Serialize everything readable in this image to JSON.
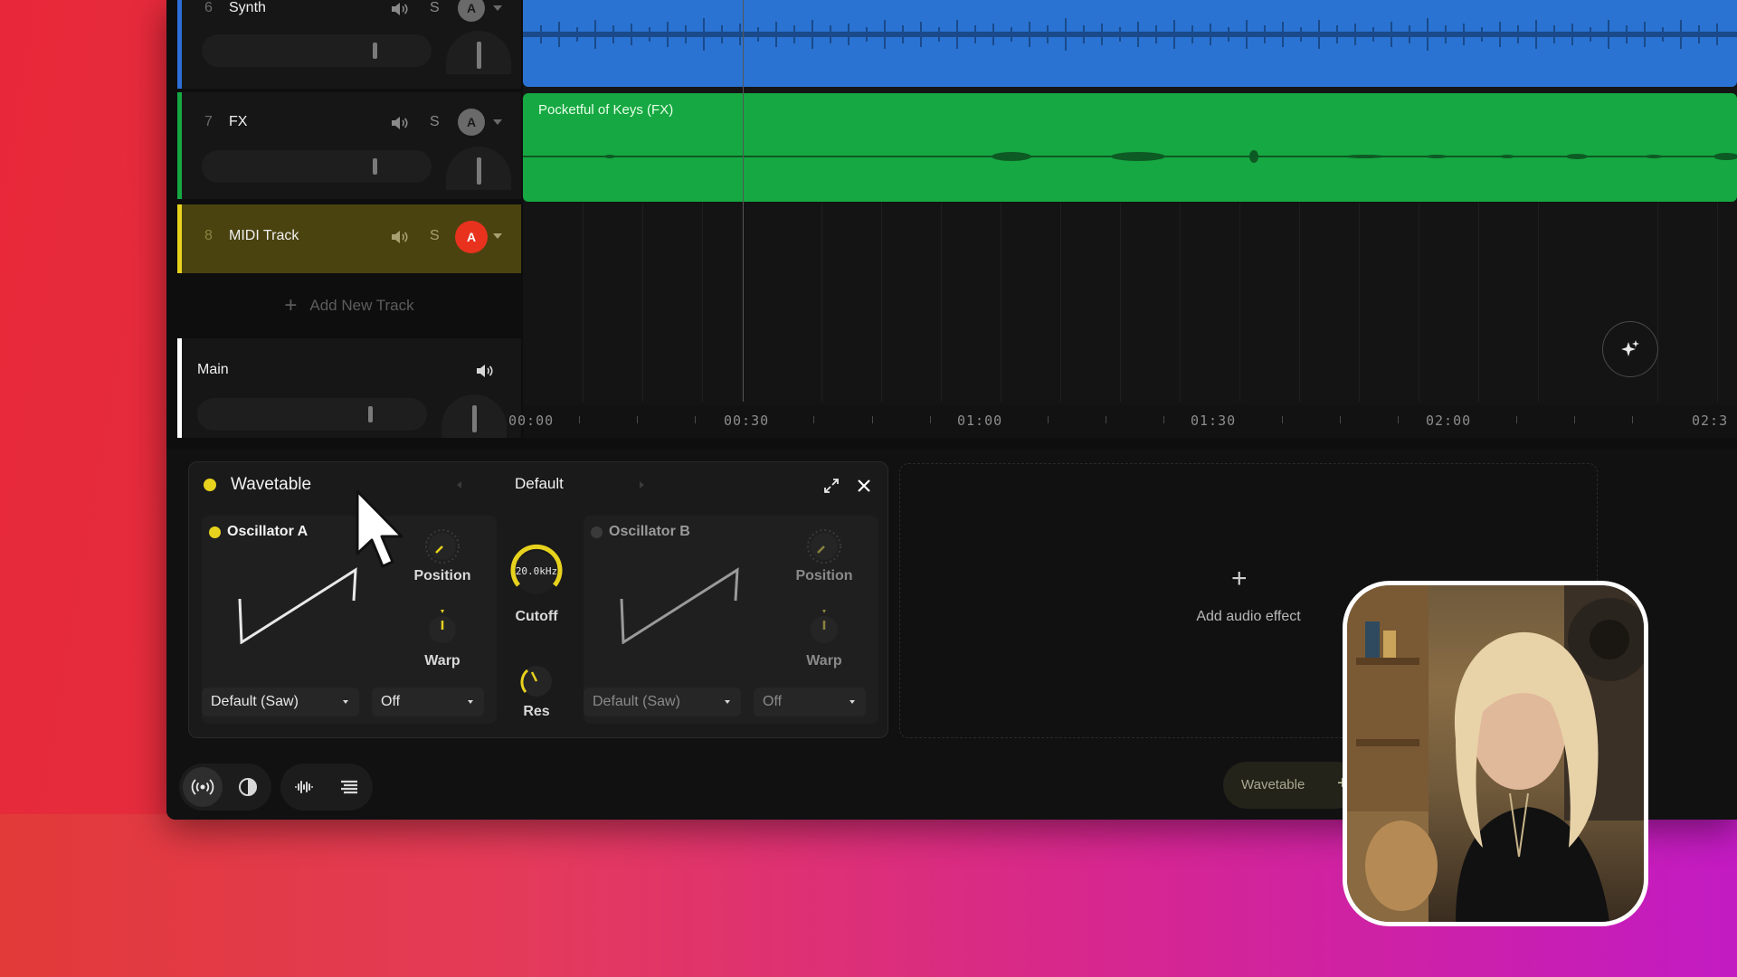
{
  "tracks": [
    {
      "num": "6",
      "name": "Synth",
      "solo": "S",
      "arm": "A"
    },
    {
      "num": "7",
      "name": "FX",
      "solo": "S",
      "arm": "A"
    },
    {
      "num": "8",
      "name": "MIDI Track",
      "solo": "S",
      "arm": "A"
    }
  ],
  "add_track_label": "Add New Track",
  "main_track": {
    "name": "Main"
  },
  "clips": {
    "fx_name": "Pocketful of Keys (FX)"
  },
  "ruler": [
    "00:00",
    "00:30",
    "01:00",
    "01:30",
    "02:00",
    "02:3"
  ],
  "wavetable": {
    "title": "Wavetable",
    "preset": "Default",
    "osc_a": {
      "name": "Oscillator A",
      "position_label": "Position",
      "warp_label": "Warp",
      "wave_select": "Default (Saw)",
      "mode_select": "Off"
    },
    "osc_b": {
      "name": "Oscillator B",
      "position_label": "Position",
      "warp_label": "Warp",
      "wave_select": "Default (Saw)",
      "mode_select": "Off"
    },
    "cutoff_value": "20.0kHz",
    "cutoff_label": "Cutoff",
    "res_label": "Res"
  },
  "add_effect_label": "Add audio effect",
  "bottom_chip_label": "Wavetable",
  "colors": {
    "accent_yellow": "#e7d21d",
    "synth_clip": "#2a73d2",
    "fx_clip": "#16a842",
    "midi_track": "#4a4310",
    "arm_active": "#e8321e"
  }
}
